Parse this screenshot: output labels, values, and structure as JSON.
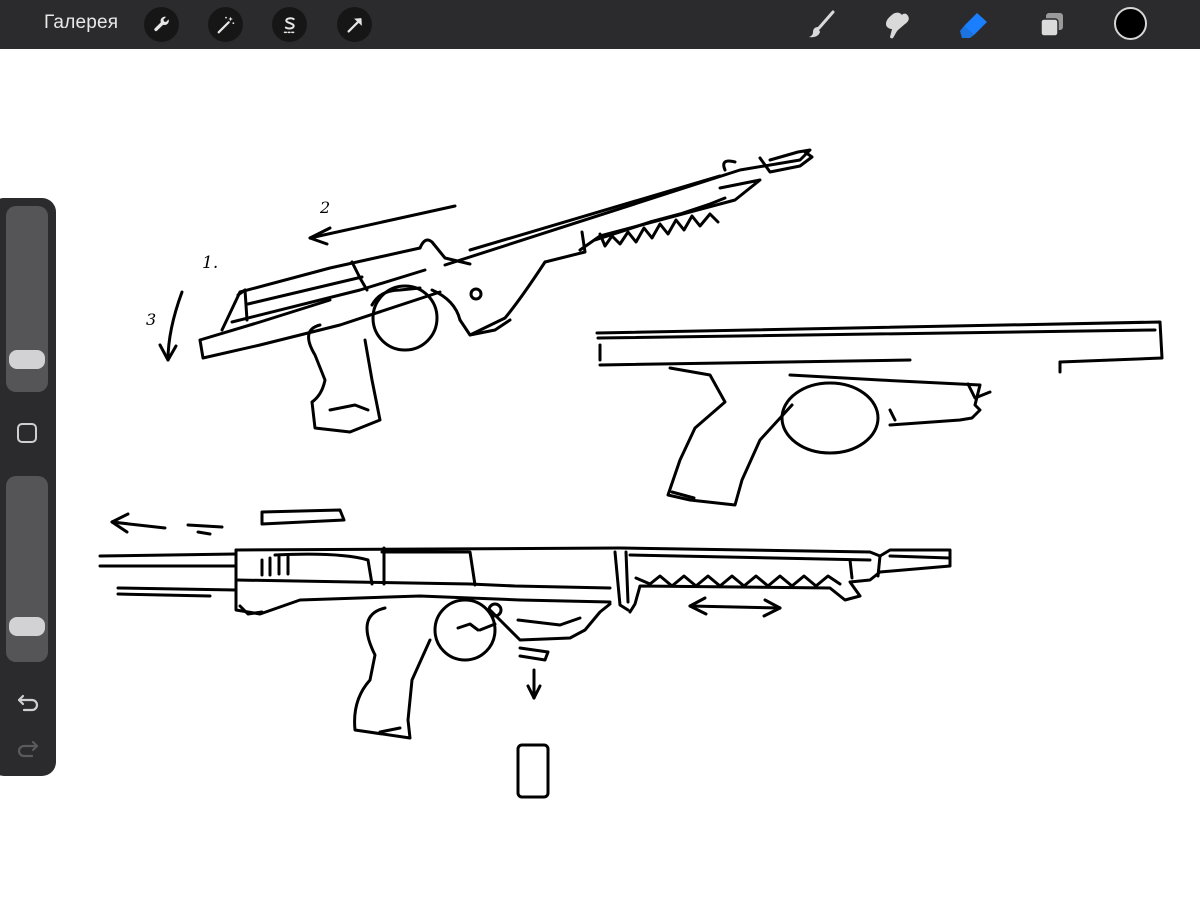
{
  "toolbar": {
    "gallery_label": "Галерея",
    "left_tools": [
      {
        "name": "actions",
        "icon": "wrench-icon"
      },
      {
        "name": "adjustments",
        "icon": "magic-wand-icon"
      },
      {
        "name": "selection",
        "icon": "selection-s-icon"
      },
      {
        "name": "transform",
        "icon": "arrow-cursor-icon"
      }
    ],
    "right_tools": [
      {
        "name": "brush",
        "icon": "brush-icon",
        "active": false
      },
      {
        "name": "smudge",
        "icon": "smudge-icon",
        "active": false
      },
      {
        "name": "eraser",
        "icon": "eraser-icon",
        "active": true
      },
      {
        "name": "layers",
        "icon": "layers-icon",
        "active": false
      }
    ],
    "current_color": "#000000",
    "active_tool_color": "#1a7fff"
  },
  "sidebar": {
    "brush_size_level": 0.12,
    "opacity_level": 0.14,
    "undo_icon": "undo-icon",
    "redo_icon": "redo-icon"
  },
  "canvas": {
    "background": "#ffffff",
    "ink_color": "#000000",
    "sketch_labels": {
      "arrow_2": "2",
      "arrow_1": "1.",
      "arrow_3": "3"
    }
  }
}
